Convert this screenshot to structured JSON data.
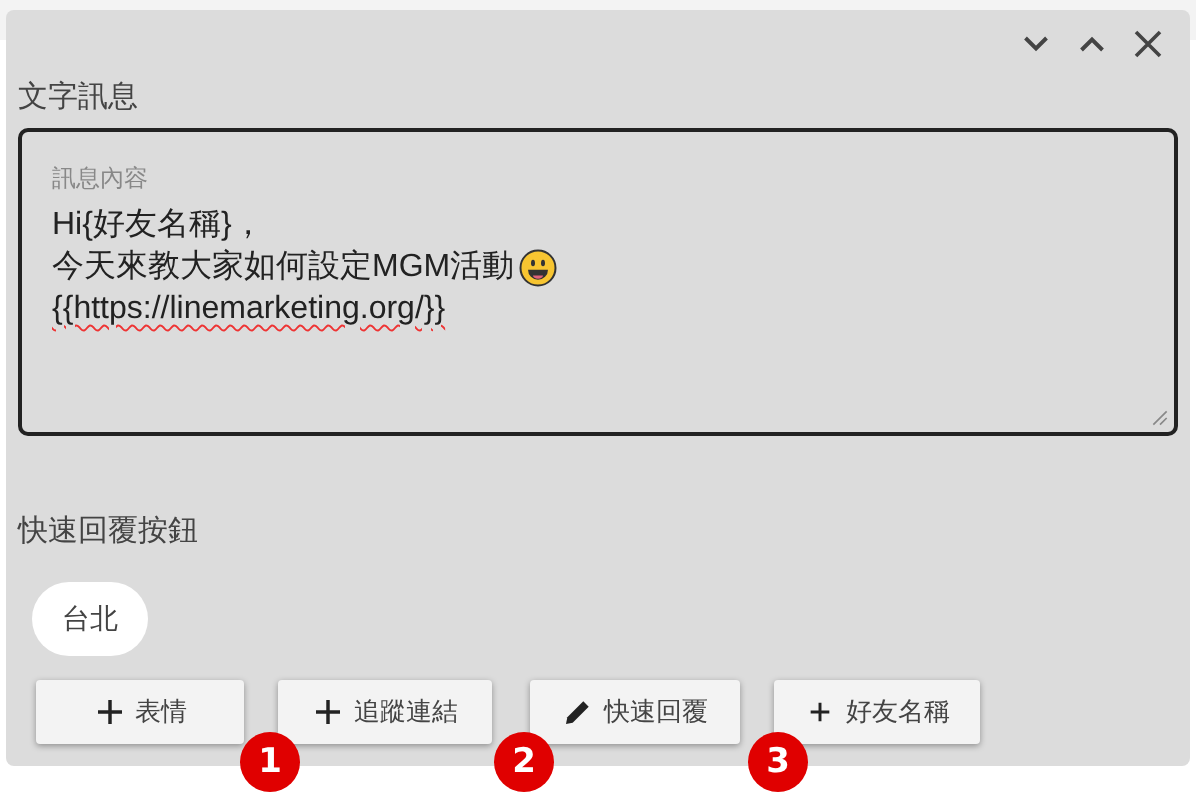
{
  "panel": {
    "window_controls": [
      {
        "kind": "collapse"
      },
      {
        "kind": "expand"
      },
      {
        "kind": "close"
      }
    ],
    "section_label": "文字訊息",
    "message": {
      "placeholder": "訊息內容",
      "lines": [
        {
          "text": "Hi{好友名稱}，",
          "emoji": false,
          "spellcheck": false
        },
        {
          "text": "今天來教大家如何設定MGM活動",
          "emoji": true,
          "spellcheck": false
        },
        {
          "text": "{{https://linemarketing.org/}}",
          "emoji": false,
          "spellcheck": true
        }
      ]
    },
    "quick_reply_label": "快速回覆按鈕",
    "quick_replies": [
      "台北"
    ],
    "buttons": [
      {
        "label": "表情",
        "kind": "plus"
      },
      {
        "label": "追蹤連結",
        "kind": "plus"
      },
      {
        "label": "快速回覆",
        "kind": "edit"
      },
      {
        "label": "好友名稱",
        "kind": "small-plus"
      }
    ],
    "badges": [
      "1",
      "2",
      "3"
    ]
  }
}
